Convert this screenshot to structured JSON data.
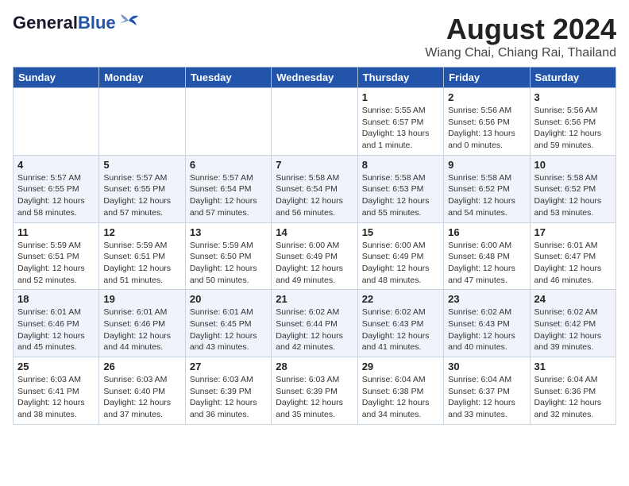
{
  "header": {
    "logo_general": "General",
    "logo_blue": "Blue",
    "month_title": "August 2024",
    "location": "Wiang Chai, Chiang Rai, Thailand"
  },
  "weekdays": [
    "Sunday",
    "Monday",
    "Tuesday",
    "Wednesday",
    "Thursday",
    "Friday",
    "Saturday"
  ],
  "weeks": [
    [
      {
        "day": "",
        "info": ""
      },
      {
        "day": "",
        "info": ""
      },
      {
        "day": "",
        "info": ""
      },
      {
        "day": "",
        "info": ""
      },
      {
        "day": "1",
        "info": "Sunrise: 5:55 AM\nSunset: 6:57 PM\nDaylight: 13 hours\nand 1 minute."
      },
      {
        "day": "2",
        "info": "Sunrise: 5:56 AM\nSunset: 6:56 PM\nDaylight: 13 hours\nand 0 minutes."
      },
      {
        "day": "3",
        "info": "Sunrise: 5:56 AM\nSunset: 6:56 PM\nDaylight: 12 hours\nand 59 minutes."
      }
    ],
    [
      {
        "day": "4",
        "info": "Sunrise: 5:57 AM\nSunset: 6:55 PM\nDaylight: 12 hours\nand 58 minutes."
      },
      {
        "day": "5",
        "info": "Sunrise: 5:57 AM\nSunset: 6:55 PM\nDaylight: 12 hours\nand 57 minutes."
      },
      {
        "day": "6",
        "info": "Sunrise: 5:57 AM\nSunset: 6:54 PM\nDaylight: 12 hours\nand 57 minutes."
      },
      {
        "day": "7",
        "info": "Sunrise: 5:58 AM\nSunset: 6:54 PM\nDaylight: 12 hours\nand 56 minutes."
      },
      {
        "day": "8",
        "info": "Sunrise: 5:58 AM\nSunset: 6:53 PM\nDaylight: 12 hours\nand 55 minutes."
      },
      {
        "day": "9",
        "info": "Sunrise: 5:58 AM\nSunset: 6:52 PM\nDaylight: 12 hours\nand 54 minutes."
      },
      {
        "day": "10",
        "info": "Sunrise: 5:58 AM\nSunset: 6:52 PM\nDaylight: 12 hours\nand 53 minutes."
      }
    ],
    [
      {
        "day": "11",
        "info": "Sunrise: 5:59 AM\nSunset: 6:51 PM\nDaylight: 12 hours\nand 52 minutes."
      },
      {
        "day": "12",
        "info": "Sunrise: 5:59 AM\nSunset: 6:51 PM\nDaylight: 12 hours\nand 51 minutes."
      },
      {
        "day": "13",
        "info": "Sunrise: 5:59 AM\nSunset: 6:50 PM\nDaylight: 12 hours\nand 50 minutes."
      },
      {
        "day": "14",
        "info": "Sunrise: 6:00 AM\nSunset: 6:49 PM\nDaylight: 12 hours\nand 49 minutes."
      },
      {
        "day": "15",
        "info": "Sunrise: 6:00 AM\nSunset: 6:49 PM\nDaylight: 12 hours\nand 48 minutes."
      },
      {
        "day": "16",
        "info": "Sunrise: 6:00 AM\nSunset: 6:48 PM\nDaylight: 12 hours\nand 47 minutes."
      },
      {
        "day": "17",
        "info": "Sunrise: 6:01 AM\nSunset: 6:47 PM\nDaylight: 12 hours\nand 46 minutes."
      }
    ],
    [
      {
        "day": "18",
        "info": "Sunrise: 6:01 AM\nSunset: 6:46 PM\nDaylight: 12 hours\nand 45 minutes."
      },
      {
        "day": "19",
        "info": "Sunrise: 6:01 AM\nSunset: 6:46 PM\nDaylight: 12 hours\nand 44 minutes."
      },
      {
        "day": "20",
        "info": "Sunrise: 6:01 AM\nSunset: 6:45 PM\nDaylight: 12 hours\nand 43 minutes."
      },
      {
        "day": "21",
        "info": "Sunrise: 6:02 AM\nSunset: 6:44 PM\nDaylight: 12 hours\nand 42 minutes."
      },
      {
        "day": "22",
        "info": "Sunrise: 6:02 AM\nSunset: 6:43 PM\nDaylight: 12 hours\nand 41 minutes."
      },
      {
        "day": "23",
        "info": "Sunrise: 6:02 AM\nSunset: 6:43 PM\nDaylight: 12 hours\nand 40 minutes."
      },
      {
        "day": "24",
        "info": "Sunrise: 6:02 AM\nSunset: 6:42 PM\nDaylight: 12 hours\nand 39 minutes."
      }
    ],
    [
      {
        "day": "25",
        "info": "Sunrise: 6:03 AM\nSunset: 6:41 PM\nDaylight: 12 hours\nand 38 minutes."
      },
      {
        "day": "26",
        "info": "Sunrise: 6:03 AM\nSunset: 6:40 PM\nDaylight: 12 hours\nand 37 minutes."
      },
      {
        "day": "27",
        "info": "Sunrise: 6:03 AM\nSunset: 6:39 PM\nDaylight: 12 hours\nand 36 minutes."
      },
      {
        "day": "28",
        "info": "Sunrise: 6:03 AM\nSunset: 6:39 PM\nDaylight: 12 hours\nand 35 minutes."
      },
      {
        "day": "29",
        "info": "Sunrise: 6:04 AM\nSunset: 6:38 PM\nDaylight: 12 hours\nand 34 minutes."
      },
      {
        "day": "30",
        "info": "Sunrise: 6:04 AM\nSunset: 6:37 PM\nDaylight: 12 hours\nand 33 minutes."
      },
      {
        "day": "31",
        "info": "Sunrise: 6:04 AM\nSunset: 6:36 PM\nDaylight: 12 hours\nand 32 minutes."
      }
    ]
  ]
}
